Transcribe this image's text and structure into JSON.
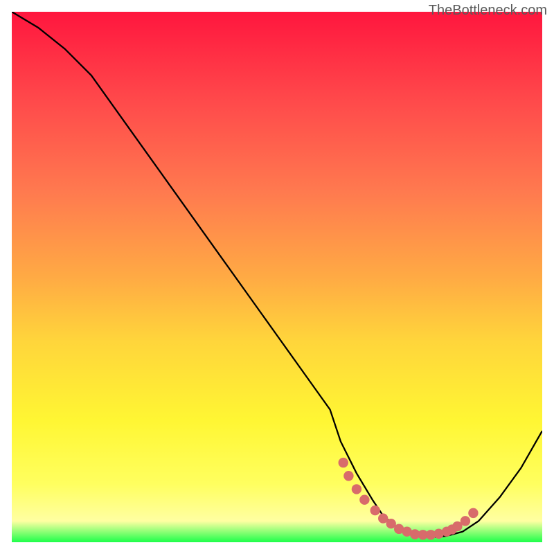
{
  "watermark": "TheBottleneck.com",
  "chart_data": {
    "type": "line",
    "title": "",
    "xlabel": "",
    "ylabel": "",
    "xlim": [
      0,
      100
    ],
    "ylim": [
      0,
      100
    ],
    "series": [
      {
        "name": "curve",
        "x": [
          0,
          5,
          10,
          15,
          20,
          25,
          30,
          35,
          40,
          45,
          50,
          55,
          60,
          62,
          65,
          68,
          70,
          73,
          75,
          78,
          80,
          82,
          85,
          88,
          92,
          96,
          100
        ],
        "y": [
          100,
          97,
          93,
          88,
          81,
          74,
          67,
          60,
          53,
          46,
          39,
          32,
          25,
          19,
          13,
          8,
          5,
          2.5,
          1.5,
          1,
          1,
          1.2,
          2,
          4,
          8.5,
          14,
          21
        ]
      }
    ],
    "dots": {
      "name": "optimal-range",
      "color": "#d86b6b",
      "x": [
        62.5,
        63.5,
        65,
        66.5,
        68.5,
        70,
        71.5,
        73,
        74.5,
        76,
        77.5,
        79,
        80.5,
        82,
        83,
        84,
        85.5,
        87
      ],
      "y": [
        15,
        12.5,
        10,
        8,
        6,
        4.5,
        3.5,
        2.5,
        2,
        1.5,
        1.4,
        1.4,
        1.6,
        2,
        2.4,
        3,
        4,
        5.5
      ]
    },
    "gradient": {
      "stops": [
        {
          "pos": 0,
          "color": "#ff163e"
        },
        {
          "pos": 17,
          "color": "#ff4a4b"
        },
        {
          "pos": 34,
          "color": "#ff7a4f"
        },
        {
          "pos": 50,
          "color": "#ffaa44"
        },
        {
          "pos": 62,
          "color": "#ffd53b"
        },
        {
          "pos": 77,
          "color": "#fff633"
        },
        {
          "pos": 89,
          "color": "#ffff5f"
        },
        {
          "pos": 96,
          "color": "#ffffa2"
        },
        {
          "pos": 100,
          "color": "#1eff4a"
        }
      ]
    }
  }
}
